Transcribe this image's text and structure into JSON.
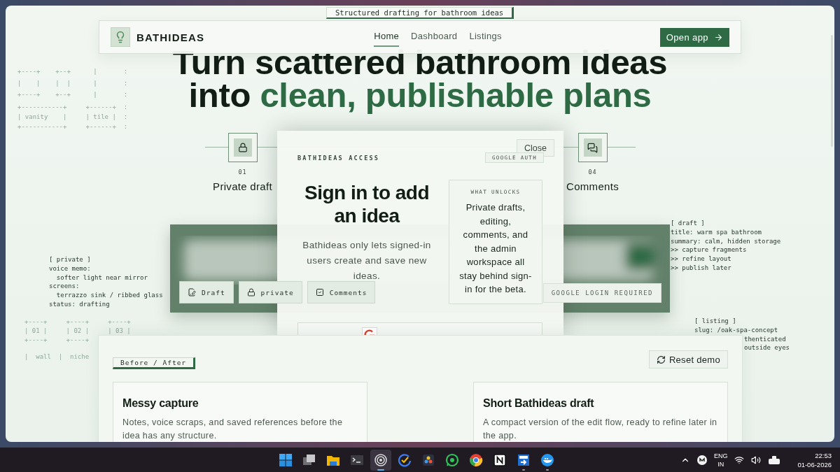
{
  "tagline": "Structured drafting for bathroom ideas",
  "nav": {
    "brand": "BATHIDEAS",
    "links": [
      {
        "label": "Home",
        "selected": true
      },
      {
        "label": "Dashboard",
        "selected": false
      },
      {
        "label": "Listings",
        "selected": false
      }
    ],
    "cta": "Open app"
  },
  "hero": {
    "lines": [
      {
        "parts": [
          {
            "text": "Turn scattered bathroom ideas",
            "accent": false
          }
        ]
      },
      {
        "parts": [
          {
            "text": "into",
            "accent": false
          },
          {
            "text": "clean, publishable plans",
            "accent": true
          }
        ]
      }
    ]
  },
  "steps": [
    {
      "kind": "lock",
      "number": "01",
      "label": "Private draft"
    },
    {
      "kind": "chat",
      "number": "04",
      "label": "Comments"
    }
  ],
  "notes_left": {
    "sketch": [
      "+----+    +--+      |       :",
      "|    |    |  |      |       :",
      "+----+    +--+      |       :"
    ],
    "sketch_labels": [
      "+-----------+     +------+  :",
      "| vanity    |     | tile |  :",
      "+-----------+     +------+  :"
    ],
    "private": [
      "[ private ]",
      "voice memo:",
      "  softer light near mirror",
      "screens:",
      "  terrazzo sink / ribbed glass",
      "status: drafting"
    ],
    "grid": [
      "+----+     +----+     +----+",
      "| 01 |     | 02 |     | 03 |",
      "+----+     +----+"
    ],
    "grid_footer": "|  wall  |  niche"
  },
  "notes_right": {
    "draft": [
      "[ draft ]",
      "title: warm spa bathroom",
      "summary: calm, hidden storage",
      ">> capture fragments",
      ">> refine layout",
      ">> publish later"
    ],
    "listing": [
      "[ listing ]",
      "slug: /oak-spa-concept"
    ],
    "listing_cut": [
      "thenticated",
      "outside eyes"
    ]
  },
  "preview": {
    "chips": [
      {
        "kind": "edit",
        "label": "Draft"
      },
      {
        "kind": "lock",
        "label": "private"
      },
      {
        "kind": "check",
        "label": "Comments"
      }
    ],
    "notice": "GOOGLE LOGIN REQUIRED"
  },
  "modal": {
    "eyebrow": "BATHIDEAS ACCESS",
    "close": "Close",
    "badge": "GOOGLE AUTH",
    "title": "Sign in to add an idea",
    "body": "Bathideas only lets signed-in users create and save new ideas.",
    "unlocks": {
      "heading": "WHAT UNLOCKS",
      "body": "Private drafts, editing, comments, and the admin workspace all stay behind sign-in for the beta."
    }
  },
  "compare": {
    "tag": "Before / After",
    "reset": "Reset demo",
    "cards": [
      {
        "title": "Messy capture",
        "body": "Notes, voice scraps, and saved references before the idea has any structure."
      },
      {
        "title": "Short Bathideas draft",
        "body": "A compact version of the edit flow, ready to refine later in the app."
      }
    ]
  },
  "taskbar": {
    "apps": [
      {
        "kind": "start",
        "selected": false,
        "running": false
      },
      {
        "kind": "taskview",
        "selected": false,
        "running": false
      },
      {
        "kind": "folder",
        "selected": false,
        "running": false
      },
      {
        "kind": "terminal",
        "selected": false,
        "running": false
      },
      {
        "kind": "target",
        "selected": true,
        "running": true
      },
      {
        "kind": "tick",
        "selected": false,
        "running": false
      },
      {
        "kind": "palette",
        "selected": false,
        "running": false
      },
      {
        "kind": "chat",
        "selected": false,
        "running": false
      },
      {
        "kind": "browser",
        "selected": false,
        "running": false
      },
      {
        "kind": "notes",
        "selected": false,
        "running": false
      },
      {
        "kind": "remote",
        "selected": false,
        "running": true
      },
      {
        "kind": "whale",
        "selected": false,
        "running": true
      }
    ],
    "tray": {
      "language": "ENG",
      "region": "IN",
      "time": "22:53",
      "date": "01-06-2026"
    }
  }
}
